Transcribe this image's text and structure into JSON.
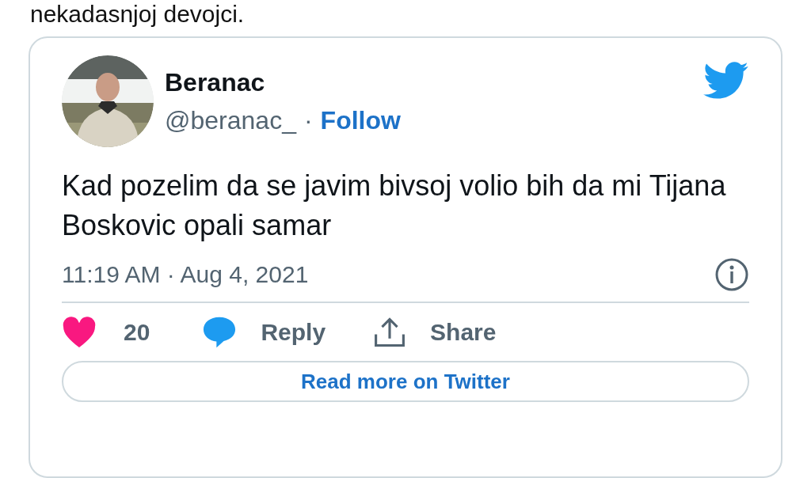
{
  "intro_text": "nekadasnjoj devojci.",
  "tweet": {
    "name": "Beranac",
    "handle": "@beranac_",
    "separator": "·",
    "follow": "Follow",
    "text": "Kad pozelim da se javim bivsoj volio bih da mi Tijana Boskovic opali samar",
    "timestamp": "11:19 AM · Aug 4, 2021",
    "likes": "20",
    "reply": "Reply",
    "share": "Share",
    "read_more": "Read more on Twitter"
  }
}
